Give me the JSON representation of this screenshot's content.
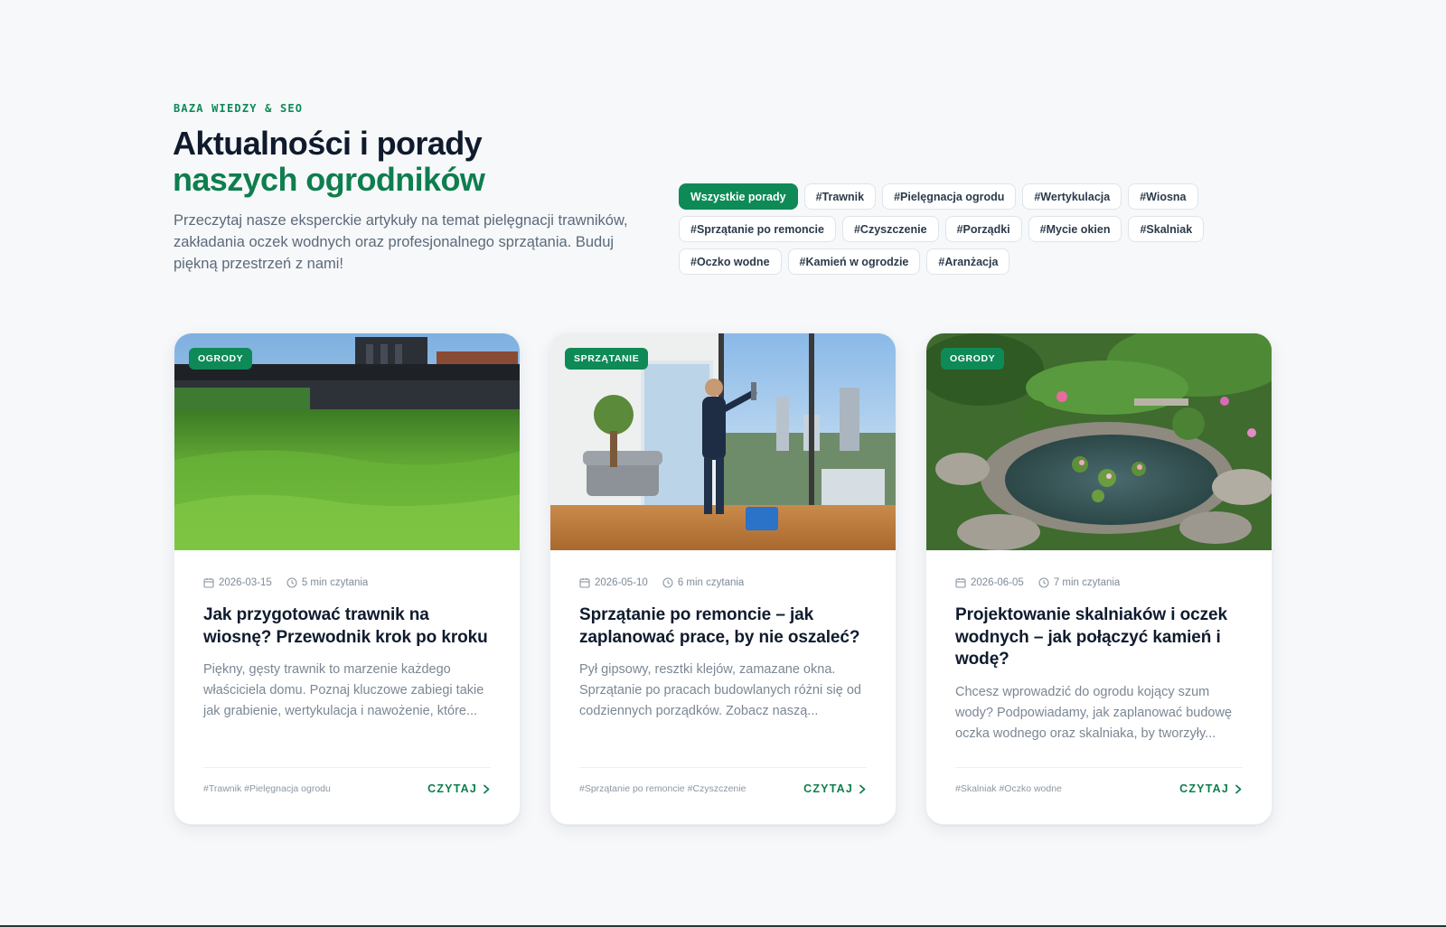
{
  "header": {
    "eyebrow": "BAZA WIEDZY & SEO",
    "title_line1": "Aktualności i porady",
    "title_line2": "naszych ogrodników",
    "lede": "Przeczytaj nasze eksperckie artykuły na temat pielęgnacji trawników, zakładania oczek wodnych oraz profesjonalnego sprzątania. Buduj piękną przestrzeń z nami!"
  },
  "filters": [
    {
      "label": "Wszystkie porady",
      "active": true
    },
    {
      "label": "#Trawnik"
    },
    {
      "label": "#Pielęgnacja ogrodu"
    },
    {
      "label": "#Wertykulacja"
    },
    {
      "label": "#Wiosna"
    },
    {
      "label": "#Sprzątanie po remoncie"
    },
    {
      "label": "#Czyszczenie"
    },
    {
      "label": "#Porządki"
    },
    {
      "label": "#Mycie okien"
    },
    {
      "label": "#Skalniak"
    },
    {
      "label": "#Oczko wodne"
    },
    {
      "label": "#Kamień w ogrodzie"
    },
    {
      "label": "#Aranżacja"
    }
  ],
  "cards": [
    {
      "badge": "OGRODY",
      "date": "2026-03-15",
      "read_time": "5 min czytania",
      "title": "Jak przygotować trawnik na wiosnę? Przewodnik krok po kroku",
      "excerpt": "Piękny, gęsty trawnik to marzenie każdego właściciela domu. Poznaj kluczowe zabiegi takie jak grabienie, wertykulacja i nawożenie, które...",
      "tags": "#Trawnik #Pielęgnacja ogrodu",
      "cta": "CZYTAJ"
    },
    {
      "badge": "SPRZĄTANIE",
      "date": "2026-05-10",
      "read_time": "6 min czytania",
      "title": "Sprzątanie po remoncie – jak zaplanować prace, by nie oszaleć?",
      "excerpt": "Pył gipsowy, resztki klejów, zamazane okna. Sprzątanie po pracach budowlanych różni się od codziennych porządków. Zobacz naszą...",
      "tags": "#Sprzątanie po remoncie #Czyszczenie",
      "cta": "CZYTAJ"
    },
    {
      "badge": "OGRODY",
      "date": "2026-06-05",
      "read_time": "7 min czytania",
      "title": "Projektowanie skalniaków i oczek wodnych – jak połączyć kamień i wodę?",
      "excerpt": "Chcesz wprowadzić do ogrodu kojący szum wody? Podpowiadamy, jak zaplanować budowę oczka wodnego oraz skalniaka, by tworzyły...",
      "tags": "#Skalniak #Oczko wodne",
      "cta": "CZYTAJ"
    }
  ],
  "colors": {
    "accent": "#0e8a57",
    "heading": "#0f1b2d",
    "muted": "#7b8794"
  },
  "icons": {
    "date": "calendar-icon",
    "time": "clock-icon",
    "cta": "chevron-right-icon"
  }
}
